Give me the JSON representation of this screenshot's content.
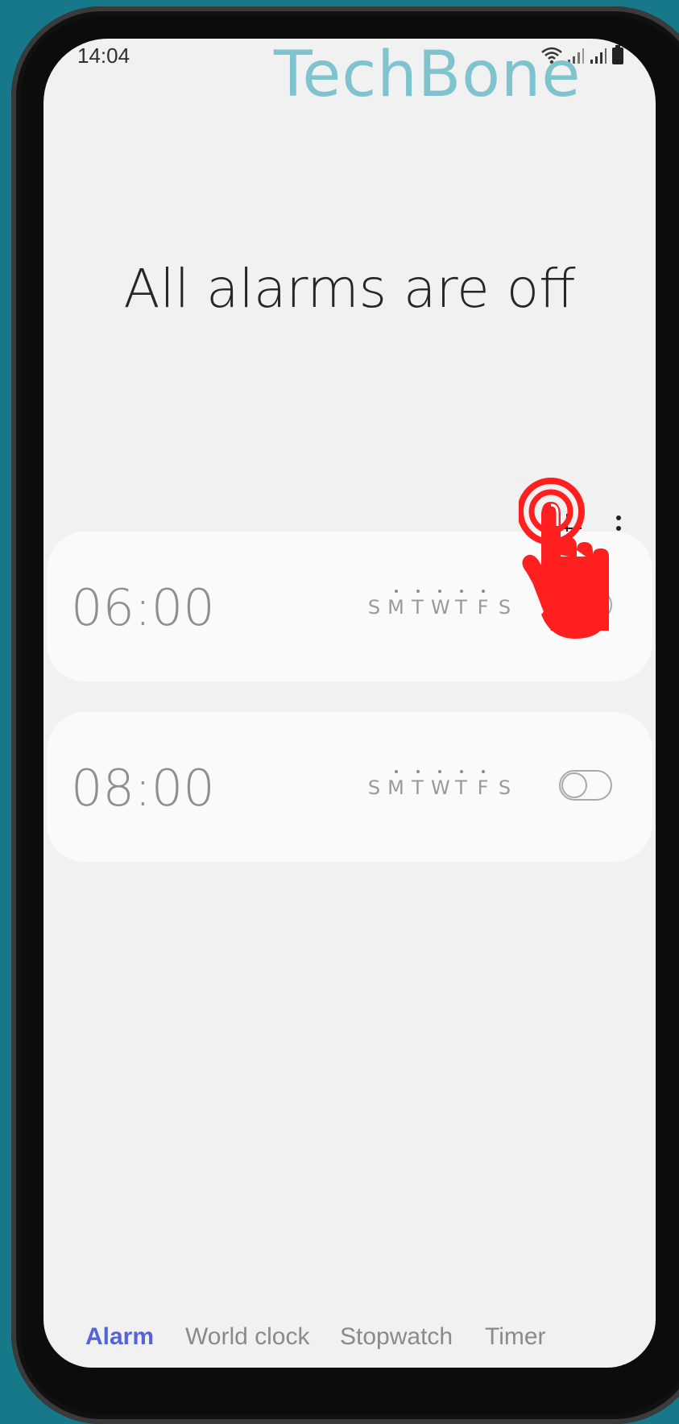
{
  "status_bar": {
    "time": "14:04",
    "icons": [
      "wifi-icon",
      "signal-icon",
      "signal-icon",
      "battery-icon"
    ]
  },
  "watermark": "TechBone",
  "headline": "All alarms are off",
  "toolbar": {
    "add_icon": "plus-icon",
    "more_icon": "more-vertical-icon"
  },
  "alarms": [
    {
      "time": "06:00",
      "days": [
        "S",
        "M",
        "T",
        "W",
        "T",
        "F",
        "S"
      ],
      "active_days": [
        false,
        true,
        true,
        true,
        true,
        true,
        false
      ],
      "enabled": false
    },
    {
      "time": "08:00",
      "days": [
        "S",
        "M",
        "T",
        "W",
        "T",
        "F",
        "S"
      ],
      "active_days": [
        false,
        true,
        true,
        true,
        true,
        true,
        false
      ],
      "enabled": false
    }
  ],
  "bottom_nav": {
    "tabs": [
      {
        "label": "Alarm",
        "active": true
      },
      {
        "label": "World clock",
        "active": false
      },
      {
        "label": "Stopwatch",
        "active": false
      },
      {
        "label": "Timer",
        "active": false
      }
    ]
  },
  "colors": {
    "background": "#17788a",
    "screen": "#f1f1f1",
    "accent": "#5563d9",
    "tap_indicator": "#ff1f1f",
    "watermark": "#7ec3cd"
  },
  "tap_indicator_icon": "tap-hand-icon"
}
